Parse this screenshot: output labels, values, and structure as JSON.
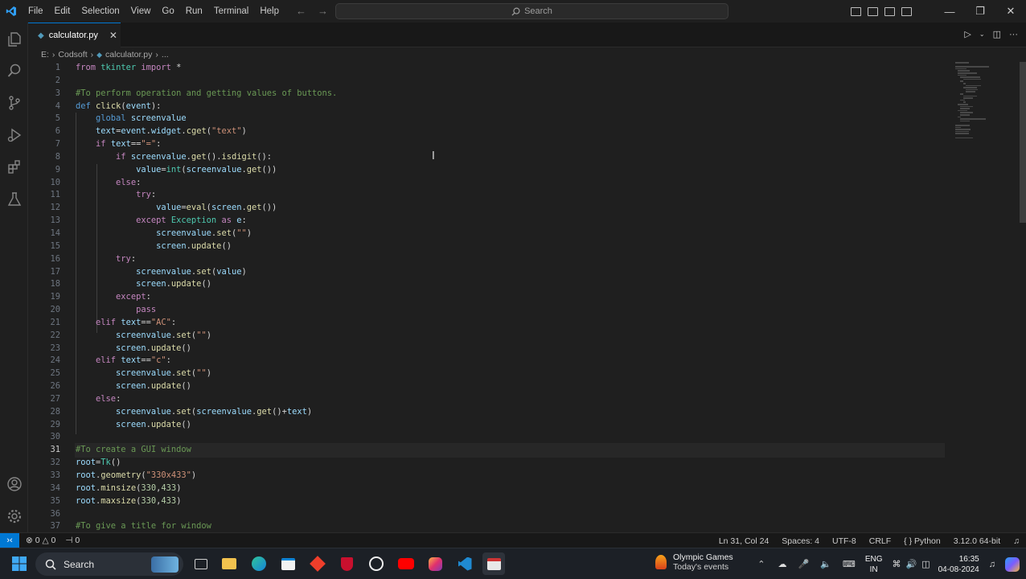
{
  "menu": [
    "File",
    "Edit",
    "Selection",
    "View",
    "Go",
    "Run",
    "Terminal",
    "Help"
  ],
  "search": {
    "placeholder": "Search"
  },
  "tab": {
    "name": "calculator.py"
  },
  "breadcrumb": {
    "drive": "E:",
    "folder": "Codsoft",
    "file": "calculator.py",
    "tail": "..."
  },
  "editor": {
    "current_line": 31,
    "lines": [
      {
        "n": "1",
        "t": [
          [
            "kw",
            "from"
          ],
          [
            "op",
            " "
          ],
          [
            "cl",
            "tkinter"
          ],
          [
            "op",
            " "
          ],
          [
            "kw",
            "import"
          ],
          [
            "op",
            " *"
          ]
        ]
      },
      {
        "n": "2",
        "t": []
      },
      {
        "n": "3",
        "t": [
          [
            "cm",
            "#To perform operation and getting values of buttons."
          ]
        ]
      },
      {
        "n": "4",
        "t": [
          [
            "kd",
            "def"
          ],
          [
            "op",
            " "
          ],
          [
            "fn",
            "click"
          ],
          [
            "op",
            "("
          ],
          [
            "vr",
            "event"
          ],
          [
            "op",
            "):"
          ]
        ]
      },
      {
        "n": "5",
        "t": [
          [
            "op",
            "    "
          ],
          [
            "kd",
            "global"
          ],
          [
            "op",
            " "
          ],
          [
            "vr",
            "screenvalue"
          ]
        ]
      },
      {
        "n": "6",
        "t": [
          [
            "op",
            "    "
          ],
          [
            "vr",
            "text"
          ],
          [
            "op",
            "="
          ],
          [
            "vr",
            "event"
          ],
          [
            "op",
            "."
          ],
          [
            "vr",
            "widget"
          ],
          [
            "op",
            "."
          ],
          [
            "fn",
            "cget"
          ],
          [
            "op",
            "("
          ],
          [
            "st",
            "\"text\""
          ],
          [
            "op",
            ")"
          ]
        ]
      },
      {
        "n": "7",
        "t": [
          [
            "op",
            "    "
          ],
          [
            "kw",
            "if"
          ],
          [
            "op",
            " "
          ],
          [
            "vr",
            "text"
          ],
          [
            "op",
            "=="
          ],
          [
            "st",
            "\"=\""
          ],
          [
            "op",
            ":"
          ]
        ]
      },
      {
        "n": "8",
        "t": [
          [
            "op",
            "        "
          ],
          [
            "kw",
            "if"
          ],
          [
            "op",
            " "
          ],
          [
            "vr",
            "screenvalue"
          ],
          [
            "op",
            "."
          ],
          [
            "fn",
            "get"
          ],
          [
            "op",
            "()."
          ],
          [
            "fn",
            "isdigit"
          ],
          [
            "op",
            "():"
          ]
        ]
      },
      {
        "n": "9",
        "t": [
          [
            "op",
            "            "
          ],
          [
            "vr",
            "value"
          ],
          [
            "op",
            "="
          ],
          [
            "cl",
            "int"
          ],
          [
            "op",
            "("
          ],
          [
            "vr",
            "screenvalue"
          ],
          [
            "op",
            "."
          ],
          [
            "fn",
            "get"
          ],
          [
            "op",
            "())"
          ]
        ]
      },
      {
        "n": "10",
        "t": [
          [
            "op",
            "        "
          ],
          [
            "kw",
            "else"
          ],
          [
            "op",
            ":"
          ]
        ]
      },
      {
        "n": "11",
        "t": [
          [
            "op",
            "            "
          ],
          [
            "kw",
            "try"
          ],
          [
            "op",
            ":"
          ]
        ]
      },
      {
        "n": "12",
        "t": [
          [
            "op",
            "                "
          ],
          [
            "vr",
            "value"
          ],
          [
            "op",
            "="
          ],
          [
            "fn",
            "eval"
          ],
          [
            "op",
            "("
          ],
          [
            "vr",
            "screen"
          ],
          [
            "op",
            "."
          ],
          [
            "fn",
            "get"
          ],
          [
            "op",
            "())"
          ]
        ]
      },
      {
        "n": "13",
        "t": [
          [
            "op",
            "            "
          ],
          [
            "kw",
            "except"
          ],
          [
            "op",
            " "
          ],
          [
            "cl",
            "Exception"
          ],
          [
            "op",
            " "
          ],
          [
            "kw",
            "as"
          ],
          [
            "op",
            " "
          ],
          [
            "vr",
            "e"
          ],
          [
            "op",
            ":"
          ]
        ]
      },
      {
        "n": "14",
        "t": [
          [
            "op",
            "                "
          ],
          [
            "vr",
            "screenvalue"
          ],
          [
            "op",
            "."
          ],
          [
            "fn",
            "set"
          ],
          [
            "op",
            "("
          ],
          [
            "st",
            "\"\""
          ],
          [
            "op",
            ")"
          ]
        ]
      },
      {
        "n": "15",
        "t": [
          [
            "op",
            "                "
          ],
          [
            "vr",
            "screen"
          ],
          [
            "op",
            "."
          ],
          [
            "fn",
            "update"
          ],
          [
            "op",
            "()"
          ]
        ]
      },
      {
        "n": "16",
        "t": [
          [
            "op",
            "        "
          ],
          [
            "kw",
            "try"
          ],
          [
            "op",
            ":"
          ]
        ]
      },
      {
        "n": "17",
        "t": [
          [
            "op",
            "            "
          ],
          [
            "vr",
            "screenvalue"
          ],
          [
            "op",
            "."
          ],
          [
            "fn",
            "set"
          ],
          [
            "op",
            "("
          ],
          [
            "vr",
            "value"
          ],
          [
            "op",
            ")"
          ]
        ]
      },
      {
        "n": "18",
        "t": [
          [
            "op",
            "            "
          ],
          [
            "vr",
            "screen"
          ],
          [
            "op",
            "."
          ],
          [
            "fn",
            "update"
          ],
          [
            "op",
            "()"
          ]
        ]
      },
      {
        "n": "19",
        "t": [
          [
            "op",
            "        "
          ],
          [
            "kw",
            "except"
          ],
          [
            "op",
            ":"
          ]
        ]
      },
      {
        "n": "20",
        "t": [
          [
            "op",
            "            "
          ],
          [
            "kw",
            "pass"
          ]
        ]
      },
      {
        "n": "21",
        "t": [
          [
            "op",
            "    "
          ],
          [
            "kw",
            "elif"
          ],
          [
            "op",
            " "
          ],
          [
            "vr",
            "text"
          ],
          [
            "op",
            "=="
          ],
          [
            "st",
            "\"AC\""
          ],
          [
            "op",
            ":"
          ]
        ]
      },
      {
        "n": "22",
        "t": [
          [
            "op",
            "        "
          ],
          [
            "vr",
            "screenvalue"
          ],
          [
            "op",
            "."
          ],
          [
            "fn",
            "set"
          ],
          [
            "op",
            "("
          ],
          [
            "st",
            "\"\""
          ],
          [
            "op",
            ")"
          ]
        ]
      },
      {
        "n": "23",
        "t": [
          [
            "op",
            "        "
          ],
          [
            "vr",
            "screen"
          ],
          [
            "op",
            "."
          ],
          [
            "fn",
            "update"
          ],
          [
            "op",
            "()"
          ]
        ]
      },
      {
        "n": "24",
        "t": [
          [
            "op",
            "    "
          ],
          [
            "kw",
            "elif"
          ],
          [
            "op",
            " "
          ],
          [
            "vr",
            "text"
          ],
          [
            "op",
            "=="
          ],
          [
            "st",
            "\"c\""
          ],
          [
            "op",
            ":"
          ]
        ]
      },
      {
        "n": "25",
        "t": [
          [
            "op",
            "        "
          ],
          [
            "vr",
            "screenvalue"
          ],
          [
            "op",
            "."
          ],
          [
            "fn",
            "set"
          ],
          [
            "op",
            "("
          ],
          [
            "st",
            "\"\""
          ],
          [
            "op",
            ")"
          ]
        ]
      },
      {
        "n": "26",
        "t": [
          [
            "op",
            "        "
          ],
          [
            "vr",
            "screen"
          ],
          [
            "op",
            "."
          ],
          [
            "fn",
            "update"
          ],
          [
            "op",
            "()"
          ]
        ]
      },
      {
        "n": "27",
        "t": [
          [
            "op",
            "    "
          ],
          [
            "kw",
            "else"
          ],
          [
            "op",
            ":"
          ]
        ]
      },
      {
        "n": "28",
        "t": [
          [
            "op",
            "        "
          ],
          [
            "vr",
            "screenvalue"
          ],
          [
            "op",
            "."
          ],
          [
            "fn",
            "set"
          ],
          [
            "op",
            "("
          ],
          [
            "vr",
            "screenvalue"
          ],
          [
            "op",
            "."
          ],
          [
            "fn",
            "get"
          ],
          [
            "op",
            "()+"
          ],
          [
            "vr",
            "text"
          ],
          [
            "op",
            ")"
          ]
        ]
      },
      {
        "n": "29",
        "t": [
          [
            "op",
            "        "
          ],
          [
            "vr",
            "screen"
          ],
          [
            "op",
            "."
          ],
          [
            "fn",
            "update"
          ],
          [
            "op",
            "()"
          ]
        ]
      },
      {
        "n": "30",
        "t": []
      },
      {
        "n": "31",
        "t": [
          [
            "cm",
            "#To create a GUI window"
          ]
        ]
      },
      {
        "n": "32",
        "t": [
          [
            "vr",
            "root"
          ],
          [
            "op",
            "="
          ],
          [
            "cl",
            "Tk"
          ],
          [
            "op",
            "()"
          ]
        ]
      },
      {
        "n": "33",
        "t": [
          [
            "vr",
            "root"
          ],
          [
            "op",
            "."
          ],
          [
            "fn",
            "geometry"
          ],
          [
            "op",
            "("
          ],
          [
            "st",
            "\"330x433\""
          ],
          [
            "op",
            ")"
          ]
        ]
      },
      {
        "n": "34",
        "t": [
          [
            "vr",
            "root"
          ],
          [
            "op",
            "."
          ],
          [
            "fn",
            "minsize"
          ],
          [
            "op",
            "("
          ],
          [
            "nm",
            "330"
          ],
          [
            "op",
            ","
          ],
          [
            "nm",
            "433"
          ],
          [
            "op",
            ")"
          ]
        ]
      },
      {
        "n": "35",
        "t": [
          [
            "vr",
            "root"
          ],
          [
            "op",
            "."
          ],
          [
            "fn",
            "maxsize"
          ],
          [
            "op",
            "("
          ],
          [
            "nm",
            "330"
          ],
          [
            "op",
            ","
          ],
          [
            "nm",
            "433"
          ],
          [
            "op",
            ")"
          ]
        ]
      },
      {
        "n": "36",
        "t": []
      },
      {
        "n": "37",
        "t": [
          [
            "cm",
            "#To give a title for window"
          ]
        ]
      }
    ]
  },
  "status": {
    "errors": "0",
    "warnings": "0",
    "ports": "0",
    "position": "Ln 31, Col 24",
    "spaces": "Spaces: 4",
    "encoding": "UTF-8",
    "eol": "CRLF",
    "language": "Python",
    "interpreter": "3.12.0 64-bit"
  },
  "taskbar": {
    "search_label": "Search",
    "news_title": "Olympic Games",
    "news_sub": "Today's events",
    "lang1": "ENG",
    "lang2": "IN",
    "time": "16:35",
    "date": "04-08-2024"
  },
  "colors": {
    "accent": "#0078d4",
    "background": "#1f1f1f"
  }
}
